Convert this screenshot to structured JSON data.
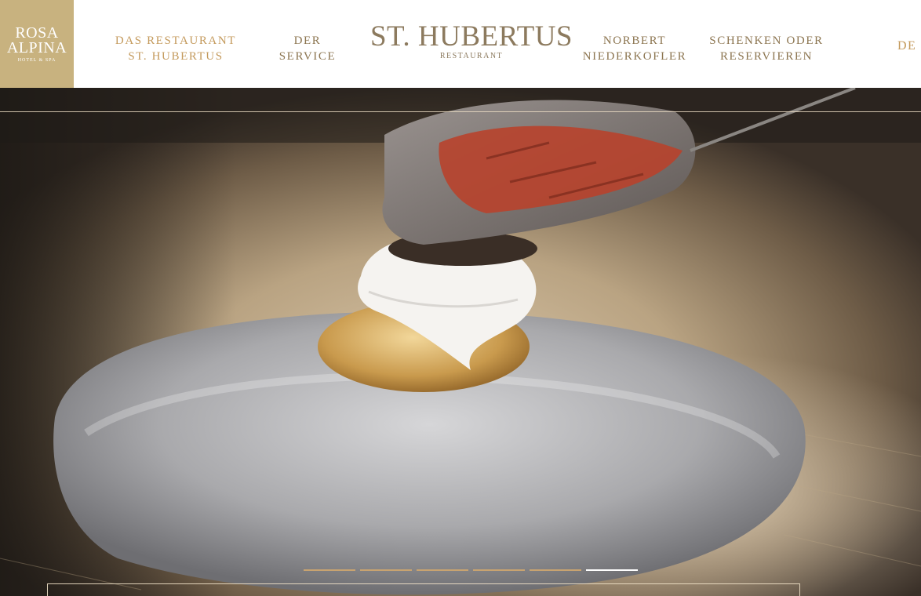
{
  "logo": {
    "line1": "ROSA",
    "line2": "ALPINA",
    "tagline": "HOTEL & SPA",
    "bg_color": "#c8b27f"
  },
  "nav": {
    "left": [
      {
        "line1": "DAS RESTAURANT",
        "line2": "ST. HUBERTUS",
        "active": true
      },
      {
        "line1": "DER",
        "line2": "SERVICE",
        "active": false
      }
    ],
    "right": [
      {
        "line1": "NORBERT",
        "line2": "NIEDERKOFLER",
        "active": false
      },
      {
        "line1": "SCHENKEN ODER",
        "line2": "RESERVIEREN",
        "active": false
      }
    ],
    "active_color": "#c49a5c",
    "text_color": "#8c7550"
  },
  "brand": {
    "title": "ST. HUBERTUS",
    "subtitle": "RESTAURANT"
  },
  "language": "DE",
  "hero": {
    "slides": {
      "count": 6,
      "active_index": 5
    }
  }
}
